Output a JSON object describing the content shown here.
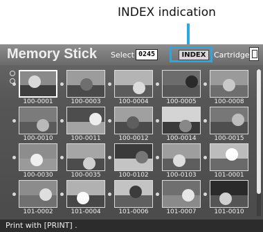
{
  "callout": {
    "label": "INDEX indication"
  },
  "header": {
    "title": "Memory Stick",
    "select_label": "Select",
    "select_count": "0245",
    "index_badge": "INDEX",
    "cartridge_label": "Cartridge",
    "colors": {
      "accent": "#2aa7e0"
    }
  },
  "thumbnails": [
    {
      "label": "100-0001",
      "sky": "#8a8a8a",
      "ground": "#3e3e3e",
      "obj": "#d8d8d8"
    },
    {
      "label": "100-0003",
      "sky": "#9c9c9c",
      "ground": "#4a4a4a",
      "obj": "#6f6f6f"
    },
    {
      "label": "100-0004",
      "sky": "#b4b4b4",
      "ground": "#5c5c5c",
      "obj": "#dcdcdc"
    },
    {
      "label": "100-0005",
      "sky": "#6c6c6c",
      "ground": "#585858",
      "obj": "#2a2a2a"
    },
    {
      "label": "100-0008",
      "sky": "#9a9a9a",
      "ground": "#6e6e6e",
      "obj": "#c9c9c9"
    },
    {
      "label": "100-0010",
      "sky": "#7b7b7b",
      "ground": "#5a5a5a",
      "obj": "#b9b9b9"
    },
    {
      "label": "100-0011",
      "sky": "#4d4d4d",
      "ground": "#a3a3a3",
      "obj": "#ededed"
    },
    {
      "label": "100-0012",
      "sky": "#a0a0a0",
      "ground": "#4b4b4b",
      "obj": "#5e5e5e"
    },
    {
      "label": "100-0014",
      "sky": "#d4d4d4",
      "ground": "#3a3a3a",
      "obj": "#888888"
    },
    {
      "label": "100-0015",
      "sky": "#777777",
      "ground": "#4e4e4e",
      "obj": "#bcbcbc"
    },
    {
      "label": "100-0030",
      "sky": "#8d8d8d",
      "ground": "#9a9a9a",
      "obj": "#efefef"
    },
    {
      "label": "100-0035",
      "sky": "#a6a6a6",
      "ground": "#4c4c4c",
      "obj": "#d0d0d0"
    },
    {
      "label": "100-0102",
      "sky": "#3a3a3a",
      "ground": "#c4c4c4",
      "obj": "#777777"
    },
    {
      "label": "100-0103",
      "sky": "#9e9e9e",
      "ground": "#5e5e5e",
      "obj": "#dedede"
    },
    {
      "label": "101-0001",
      "sky": "#bcbcbc",
      "ground": "#6a6a6a",
      "obj": "#ffffff"
    },
    {
      "label": "101-0002",
      "sky": "#8c8c8c",
      "ground": "#707070",
      "obj": "#dedede"
    },
    {
      "label": "101-0004",
      "sky": "#b1b1b1",
      "ground": "#474747",
      "obj": "#fafafa"
    },
    {
      "label": "101-0006",
      "sky": "#c3c3c3",
      "ground": "#5f5f5f",
      "obj": "#3c3c3c"
    },
    {
      "label": "101-0007",
      "sky": "#6f6f6f",
      "ground": "#8a8a8a",
      "obj": "#e6e6e6"
    },
    {
      "label": "101-0010",
      "sky": "#2a2a2a",
      "ground": "#555555",
      "obj": "#d0d0d0"
    }
  ],
  "footer": {
    "hint": "Print with [PRINT] ."
  }
}
